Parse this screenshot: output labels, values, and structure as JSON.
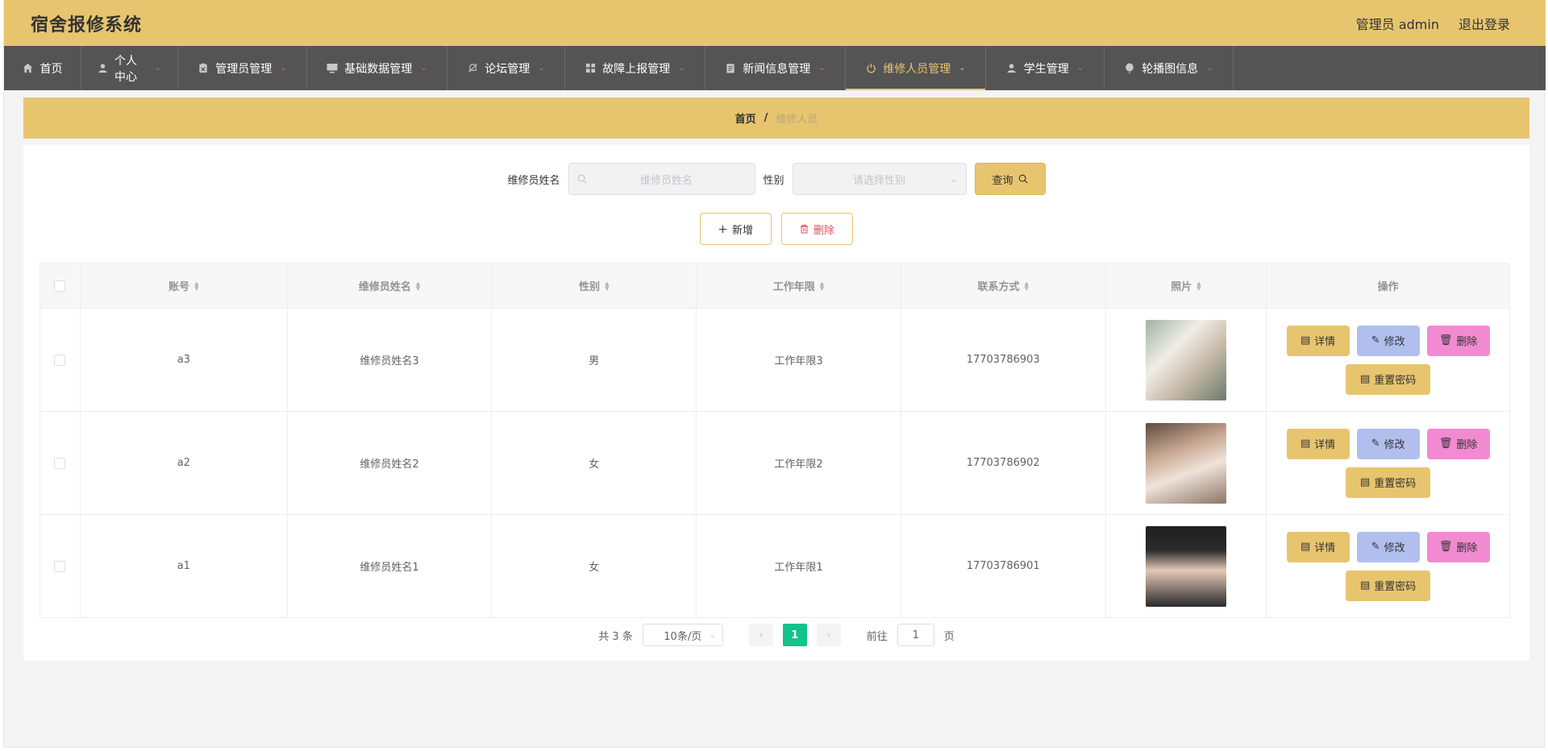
{
  "header": {
    "title": "宿舍报修系统",
    "user_label": "管理员 admin",
    "logout": "退出登录"
  },
  "nav": [
    {
      "label": "首页",
      "icon": "home-icon"
    },
    {
      "label": "个人中心",
      "icon": "user-icon"
    },
    {
      "label": "管理员管理",
      "icon": "clipboard-icon"
    },
    {
      "label": "基础数据管理",
      "icon": "monitor-icon"
    },
    {
      "label": "论坛管理",
      "icon": "bell-off-icon"
    },
    {
      "label": "故障上报管理",
      "icon": "grid-icon"
    },
    {
      "label": "新闻信息管理",
      "icon": "document-icon"
    },
    {
      "label": "维修人员管理",
      "icon": "power-icon",
      "active": true
    },
    {
      "label": "学生管理",
      "icon": "user-icon"
    },
    {
      "label": "轮播图信息",
      "icon": "balloon-icon"
    }
  ],
  "breadcrumb": {
    "home": "首页",
    "separator": "/",
    "current": "维修人员"
  },
  "search": {
    "name_label": "维修员姓名",
    "name_placeholder": "维修员姓名",
    "gender_label": "性别",
    "gender_placeholder": "请选择性别",
    "query_button": "查询"
  },
  "actions": {
    "add": "新增",
    "delete": "删除"
  },
  "table": {
    "headers": [
      "账号",
      "维修员姓名",
      "性别",
      "工作年限",
      "联系方式",
      "照片",
      "操作"
    ],
    "rows": [
      {
        "account": "a3",
        "name": "维修员姓名3",
        "gender": "男",
        "years": "工作年限3",
        "phone": "17703786903"
      },
      {
        "account": "a2",
        "name": "维修员姓名2",
        "gender": "女",
        "years": "工作年限2",
        "phone": "17703786902"
      },
      {
        "account": "a1",
        "name": "维修员姓名1",
        "gender": "女",
        "years": "工作年限1",
        "phone": "17703786901"
      }
    ],
    "row_buttons": {
      "detail": "详情",
      "edit": "修改",
      "delete": "删除",
      "reset": "重置密码"
    }
  },
  "pagination": {
    "total": "共 3 条",
    "page_size": "10条/页",
    "current_page": "1",
    "goto_prefix": "前往",
    "goto_value": "1",
    "goto_suffix": "页"
  }
}
